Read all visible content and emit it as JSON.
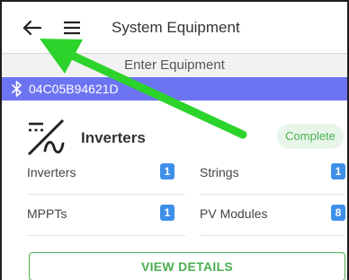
{
  "appbar": {
    "title": "System Equipment",
    "back_icon": "back-arrow-icon",
    "menu_icon": "hamburger-menu-icon"
  },
  "subheader": {
    "text": "Enter Equipment"
  },
  "bluetooth": {
    "device_id": "04C05B94621D",
    "icon": "bluetooth-icon",
    "color": "#6d74f2"
  },
  "card": {
    "title": "Inverters",
    "icon": "inverter-icon",
    "status": "Complete",
    "status_color": "#4caf50",
    "rows": [
      {
        "label": "Inverters",
        "count": "1"
      },
      {
        "label": "Strings",
        "count": "1"
      },
      {
        "label": "MPPTs",
        "count": "1"
      },
      {
        "label": "PV Modules",
        "count": "8"
      }
    ],
    "view_details": "VIEW DETAILS"
  },
  "annotation": {
    "arrow_color": "#2bd32b"
  }
}
